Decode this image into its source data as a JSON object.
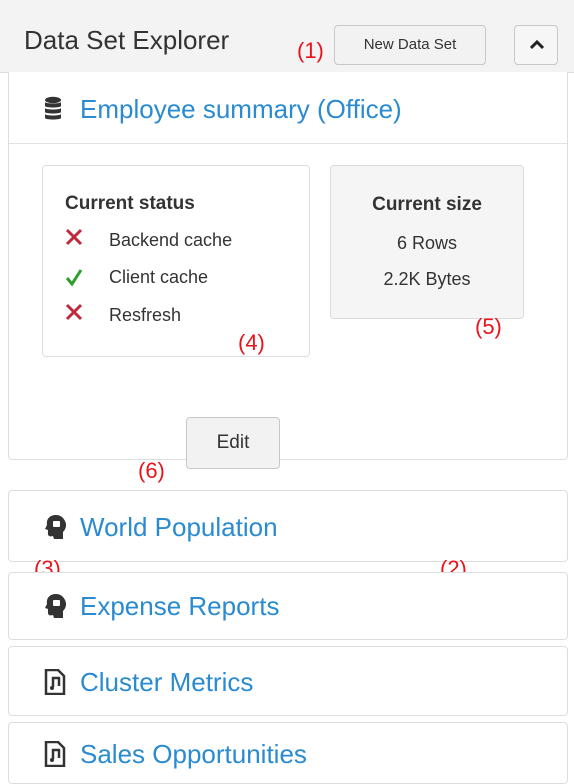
{
  "header": {
    "title": "Data Set Explorer",
    "new_button": "New Data Set",
    "collapse_icon": "chevron-up-icon"
  },
  "annotations": {
    "a1": "(1)",
    "a2": "(2)",
    "a3": "(3)",
    "a4": "(4)",
    "a5": "(5)",
    "a6": "(6)"
  },
  "expanded": {
    "title": "Employee summary (Office)",
    "icon": "database-icon",
    "status": {
      "heading": "Current status",
      "items": [
        {
          "label": "Backend cache",
          "state": "error"
        },
        {
          "label": "Client cache",
          "state": "ok"
        },
        {
          "label": "Resfresh",
          "state": "error"
        }
      ]
    },
    "size": {
      "heading": "Current size",
      "rows": "6 Rows",
      "bytes": "2.2K Bytes"
    },
    "edit_button": "Edit"
  },
  "datasets": [
    {
      "title": "World Population",
      "icon": "service-head-icon"
    },
    {
      "title": "Expense Reports",
      "icon": "service-head-icon"
    },
    {
      "title": "Cluster Metrics",
      "icon": "document-icon"
    },
    {
      "title": "Sales Opportunities",
      "icon": "document-icon"
    }
  ],
  "colors": {
    "link": "#2a8bd0",
    "error": "#c0283c",
    "ok": "#2e9e2e",
    "annotation": "#e8141a"
  }
}
